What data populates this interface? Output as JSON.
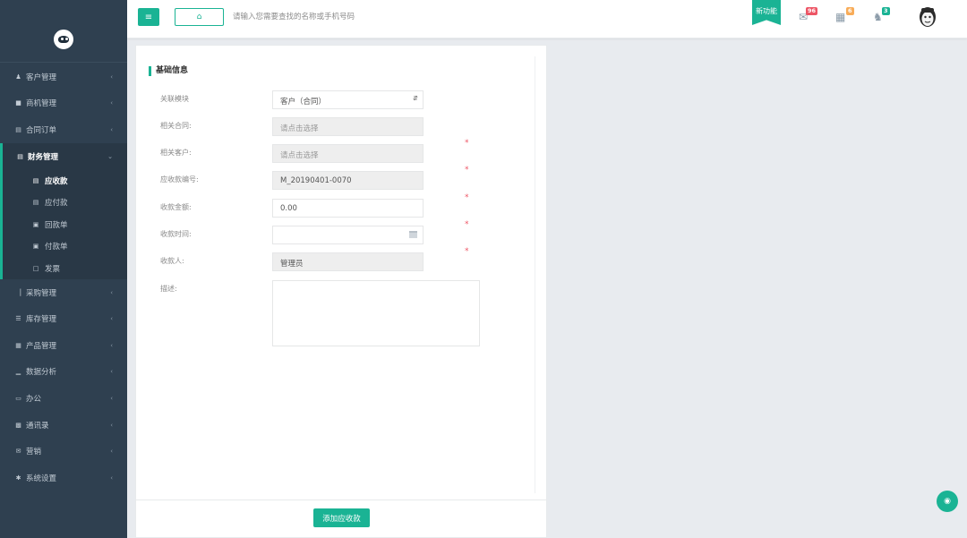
{
  "topbar": {
    "search_placeholder": "请输入您需要查找的名称或手机号码",
    "new_feature": "新功能",
    "badges": {
      "messages": "96",
      "calendar": "6",
      "notifications": "3"
    }
  },
  "sidebar": {
    "items": [
      {
        "label": "客户管理",
        "icon": "user-icon"
      },
      {
        "label": "商机管理",
        "icon": "briefcase-icon"
      },
      {
        "label": "合同订单",
        "icon": "list-icon"
      },
      {
        "label": "财务管理",
        "icon": "card-icon"
      },
      {
        "label": "采购管理",
        "icon": "cart-icon"
      },
      {
        "label": "库存管理",
        "icon": "database-icon"
      },
      {
        "label": "产品管理",
        "icon": "grid-icon"
      },
      {
        "label": "数据分析",
        "icon": "chart-icon"
      },
      {
        "label": "办公",
        "icon": "monitor-icon"
      },
      {
        "label": "通讯录",
        "icon": "contacts-icon"
      },
      {
        "label": "营销",
        "icon": "mail-icon"
      },
      {
        "label": "系统设置",
        "icon": "gear-icon"
      }
    ],
    "finance_sub": [
      {
        "label": "应收款",
        "icon": "card-icon"
      },
      {
        "label": "应付款",
        "icon": "card-icon"
      },
      {
        "label": "回款单",
        "icon": "money-icon"
      },
      {
        "label": "付款单",
        "icon": "money-icon"
      },
      {
        "label": "发票",
        "icon": "file-icon"
      }
    ]
  },
  "form": {
    "section_title": "基础信息",
    "module_label": "关联模块",
    "module_value": "客户（合同）",
    "contract_label": "相关合同:",
    "contract_placeholder": "请点击选择",
    "customer_label": "相关客户:",
    "customer_placeholder": "请点击选择",
    "number_label": "应收款编号:",
    "number_value": "M_20190401-0070",
    "amount_label": "收款金额:",
    "amount_value": "0.00",
    "time_label": "收款时间:",
    "time_value": "",
    "payee_label": "收款人:",
    "payee_value": "管理员",
    "desc_label": "描述:",
    "submit_label": "添加应收款",
    "required_mark": "*"
  },
  "colors": {
    "accent": "#1ab394",
    "sidebar": "#2f4050",
    "required": "#ed5565"
  }
}
